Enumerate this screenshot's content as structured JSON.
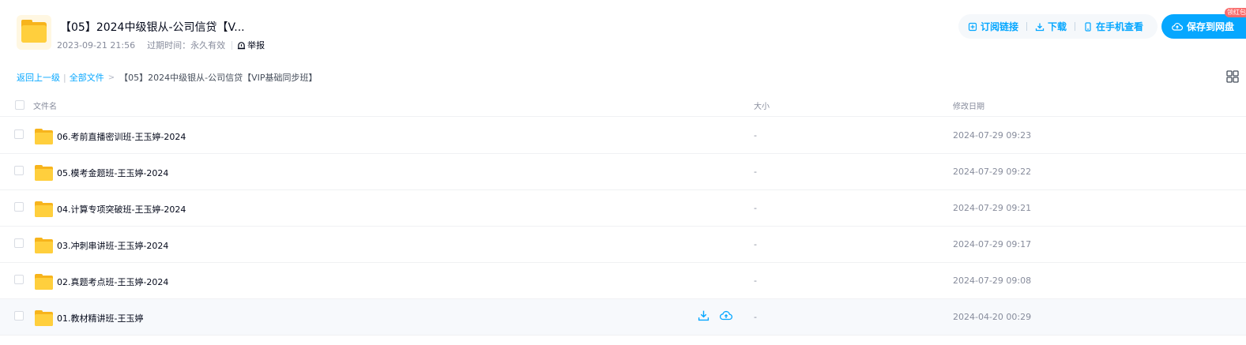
{
  "header": {
    "title": "【05】2024中级银从-公司信贷【V...",
    "date": "2023-09-21 21:56",
    "expiry_label": "过期时间：",
    "expiry_value": "永久有效",
    "report": "举报",
    "folder_icon": "folder-icon"
  },
  "actions": {
    "subscribe": "订阅链接",
    "download": "下载",
    "mobile": "在手机查看",
    "save": "保存到网盘",
    "badge": "领红包"
  },
  "breadcrumb": {
    "back": "返回上一级",
    "all_files": "全部文件",
    "arrow": ">",
    "current": "【05】2024中级银从-公司信贷【VIP基础同步班】"
  },
  "table": {
    "columns": {
      "name": "文件名",
      "size": "大小",
      "modified": "修改日期"
    },
    "rows": [
      {
        "name": "06.考前直播密训班-王玉婷-2024",
        "size": "-",
        "modified": "2024-07-29 09:23"
      },
      {
        "name": "05.模考金题班-王玉婷-2024",
        "size": "-",
        "modified": "2024-07-29 09:22"
      },
      {
        "name": "04.计算专项突破班-王玉婷-2024",
        "size": "-",
        "modified": "2024-07-29 09:21"
      },
      {
        "name": "03.冲刺串讲班-王玉婷-2024",
        "size": "-",
        "modified": "2024-07-29 09:17"
      },
      {
        "name": "02.真题考点班-王玉婷-2024",
        "size": "-",
        "modified": "2024-07-29 09:08"
      },
      {
        "name": "01.教材精讲班-王玉婷",
        "size": "-",
        "modified": "2024-04-20 00:29"
      }
    ]
  },
  "colors": {
    "accent": "#06a7ff",
    "folder": "#ffcf3d",
    "text_primary": "#03081a",
    "text_secondary": "#878c9c",
    "badge": "#f96b6b"
  }
}
